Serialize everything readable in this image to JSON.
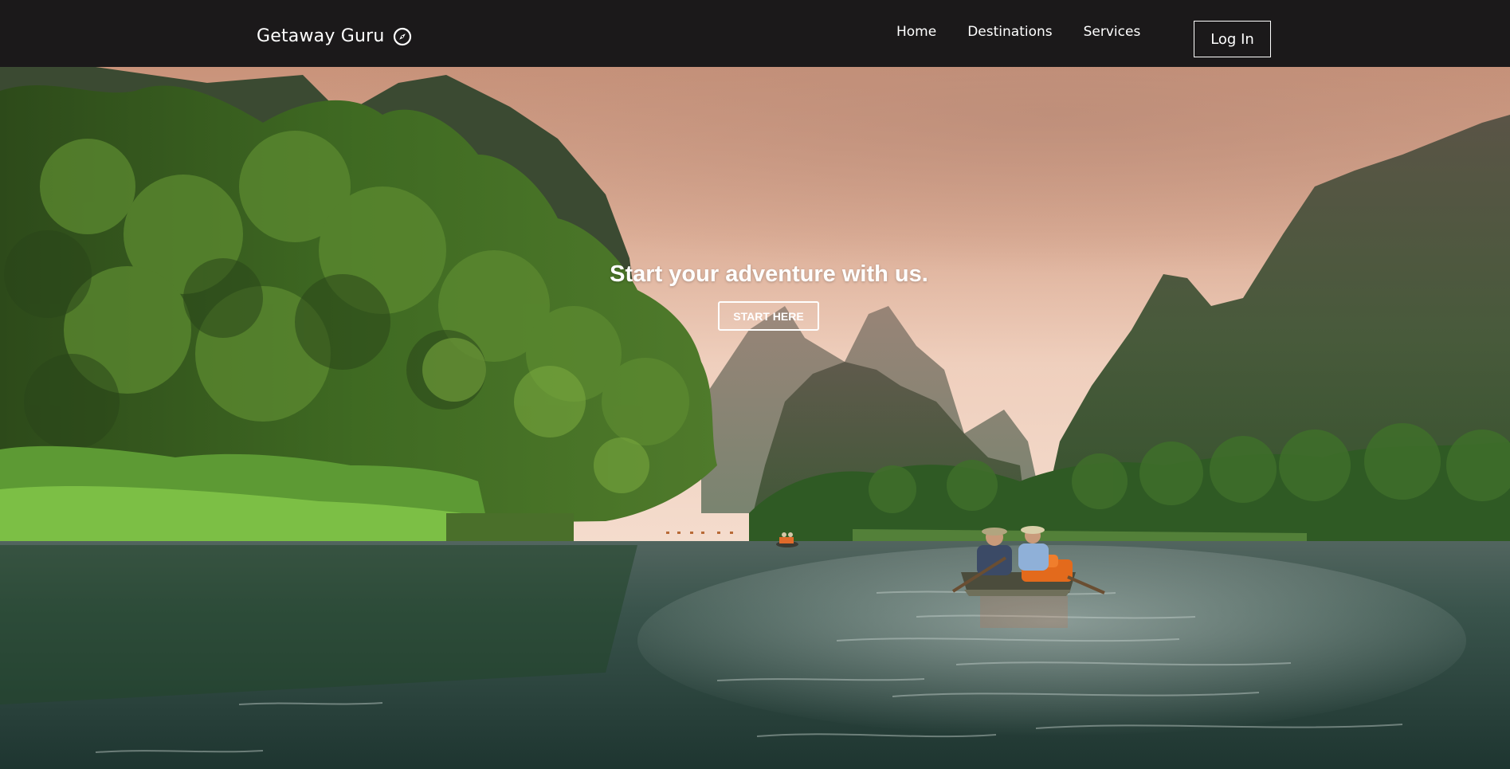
{
  "header": {
    "brand": "Getaway Guru",
    "brand_icon": "compass-icon",
    "nav": [
      {
        "label": "Home"
      },
      {
        "label": "Destinations"
      },
      {
        "label": "Services"
      }
    ],
    "login_label": "Log In"
  },
  "hero": {
    "title": "Start your adventure with us.",
    "cta_label": "START HERE",
    "background": "river-valley-boat-photo"
  },
  "colors": {
    "navbar_bg": "#1b191a",
    "text": "#ffffff",
    "sky": "#e8b9a0",
    "foliage": "#3f6b22",
    "water": "#2f4c45"
  }
}
